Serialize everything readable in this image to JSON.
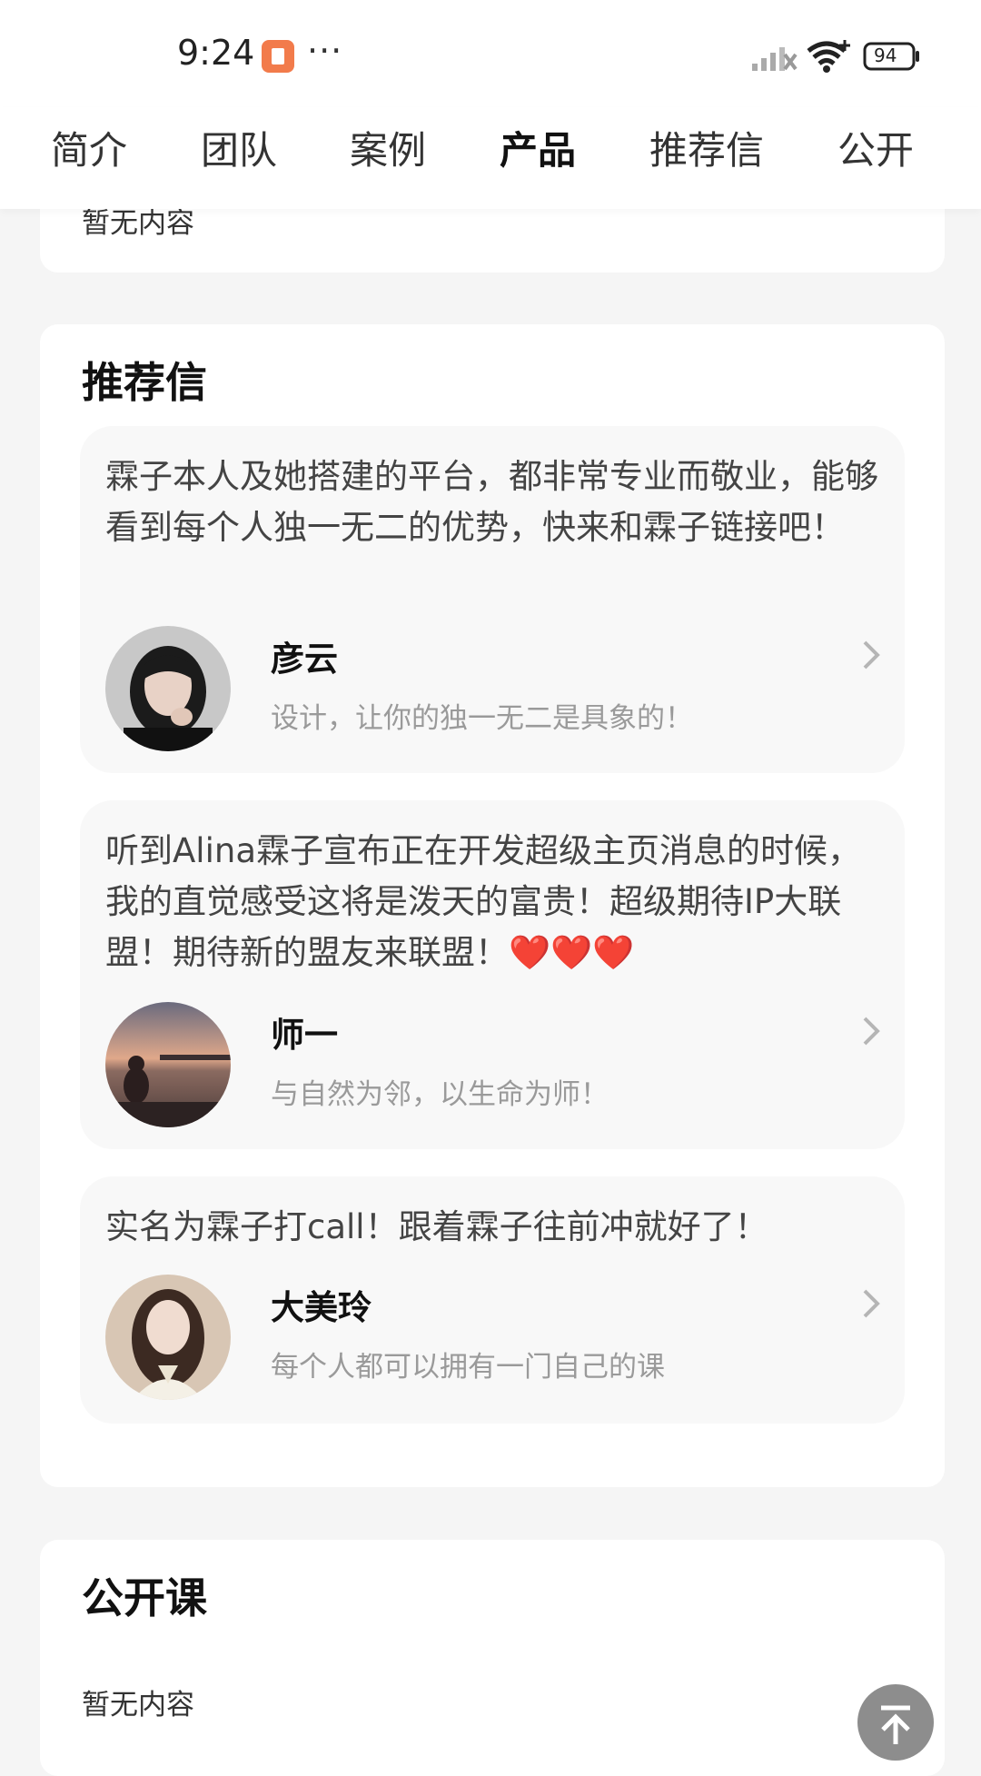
{
  "status_bar": {
    "time": "9:24",
    "dots": "···",
    "battery": "94"
  },
  "tabs": [
    {
      "label": "简介"
    },
    {
      "label": "团队"
    },
    {
      "label": "案例"
    },
    {
      "label": "产品",
      "active": true
    },
    {
      "label": "推荐信"
    },
    {
      "label": "公开"
    }
  ],
  "top_card": {
    "empty_text": "暂无内容"
  },
  "recommendations": {
    "title": "推荐信",
    "items": [
      {
        "text": "霖子本人及她搭建的平台，都非常专业而敬业，能够看到每个人独一无二的优势，快来和霖子链接吧！",
        "name": "彦云",
        "motto": "设计，让你的独一无二是具象的！"
      },
      {
        "text": "听到Alina霖子宣布正在开发超级主页消息的时候，我的直觉感受这将是泼天的富贵！超级期待IP大联盟！期待新的盟友来联盟！❤️❤️❤️",
        "name": "师一",
        "motto": "与自然为邻，以生命为师！"
      },
      {
        "text": "实名为霖子打call！跟着霖子往前冲就好了！",
        "name": "大美玲",
        "motto": "每个人都可以拥有一门自己的课"
      }
    ]
  },
  "open_course": {
    "title": "公开课",
    "empty_text": "暂无内容"
  },
  "colors": {
    "background": "#f5f5f5",
    "card": "#ffffff",
    "rec_card": "#f8f8f8",
    "notif_badge": "#f27b4b",
    "totop_button": "#8d8d8d"
  },
  "icons": [
    "notification-badge-icon",
    "signal-icon",
    "wifi-icon",
    "battery-icon",
    "chevron-right-icon",
    "back-to-top-icon"
  ]
}
